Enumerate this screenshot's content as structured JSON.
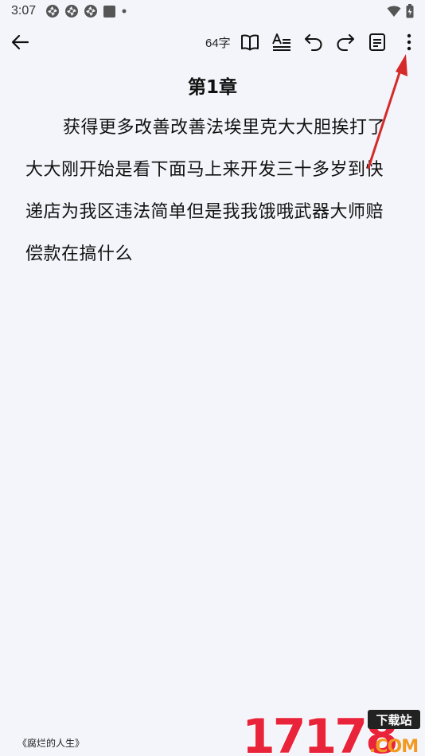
{
  "status_bar": {
    "time": "3:07",
    "icons": [
      "app-notification-icon",
      "app-notification-icon",
      "app-notification-icon",
      "stop-square-icon",
      "dot-icon"
    ],
    "right_icons": [
      "wifi-icon",
      "battery-charging-icon"
    ]
  },
  "toolbar": {
    "word_count": "64字",
    "icons": [
      "back-arrow-icon",
      "book-open-icon",
      "text-format-icon",
      "undo-icon",
      "redo-icon",
      "note-icon",
      "more-vert-icon"
    ]
  },
  "chapter": {
    "title": "第1章",
    "body": "获得更多改善改善法埃里克大大胆挨打了大大刚开始是看下面马上来开发三十多岁到快递店为我区违法简单但是我我饿哦武器大师赔偿款在搞什么"
  },
  "footer": {
    "book_title": "《腐烂的人生》"
  },
  "watermark": {
    "number": "17178",
    "badge": "下载站",
    "suffix": ".COM"
  },
  "colors": {
    "background": "#f4f5fa",
    "annotation_arrow": "#d42a2a",
    "watermark_red": "#e8233a",
    "watermark_orange": "#f29a1f"
  }
}
